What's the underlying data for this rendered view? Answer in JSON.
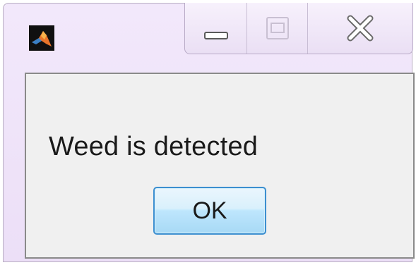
{
  "window": {
    "icon": "matlab-logo-icon",
    "caption_buttons": [
      "minimize-icon",
      "maximize-icon",
      "close-icon"
    ]
  },
  "dialog": {
    "message": "Weed is detected",
    "ok_label": "OK"
  },
  "colors": {
    "titlebar": "#ecdff7",
    "client_bg": "#f0f0f0",
    "ok_border": "#3c8fd0"
  }
}
